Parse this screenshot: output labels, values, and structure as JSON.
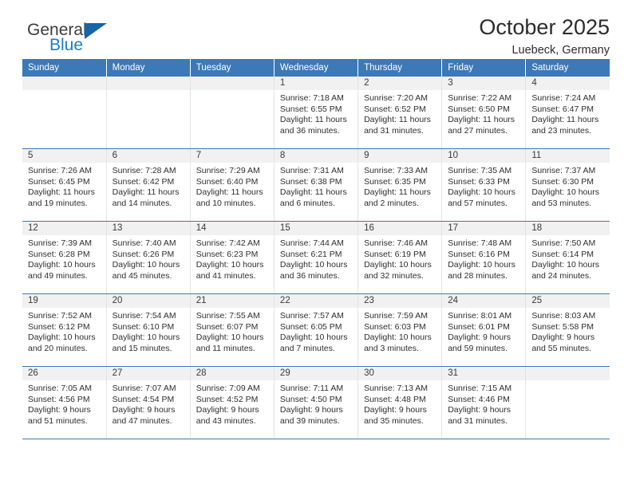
{
  "brand": {
    "name_top": "General",
    "name_bottom": "Blue",
    "flag_color": "#1565a8",
    "blue_color": "#1f7cc4"
  },
  "header": {
    "title": "October 2025",
    "subtitle": "Luebeck, Germany",
    "header_bg": "#3b79b8",
    "header_text_color": "#ffffff",
    "daynum_bg": "#f1f1f1"
  },
  "weekday_headers": [
    "Sunday",
    "Monday",
    "Tuesday",
    "Wednesday",
    "Thursday",
    "Friday",
    "Saturday"
  ],
  "weeks": [
    [
      {
        "day": "",
        "sunrise": "",
        "sunset": "",
        "daylight_1": "",
        "daylight_2": ""
      },
      {
        "day": "",
        "sunrise": "",
        "sunset": "",
        "daylight_1": "",
        "daylight_2": ""
      },
      {
        "day": "",
        "sunrise": "",
        "sunset": "",
        "daylight_1": "",
        "daylight_2": ""
      },
      {
        "day": "1",
        "sunrise": "Sunrise: 7:18 AM",
        "sunset": "Sunset: 6:55 PM",
        "daylight_1": "Daylight: 11 hours",
        "daylight_2": "and 36 minutes."
      },
      {
        "day": "2",
        "sunrise": "Sunrise: 7:20 AM",
        "sunset": "Sunset: 6:52 PM",
        "daylight_1": "Daylight: 11 hours",
        "daylight_2": "and 31 minutes."
      },
      {
        "day": "3",
        "sunrise": "Sunrise: 7:22 AM",
        "sunset": "Sunset: 6:50 PM",
        "daylight_1": "Daylight: 11 hours",
        "daylight_2": "and 27 minutes."
      },
      {
        "day": "4",
        "sunrise": "Sunrise: 7:24 AM",
        "sunset": "Sunset: 6:47 PM",
        "daylight_1": "Daylight: 11 hours",
        "daylight_2": "and 23 minutes."
      }
    ],
    [
      {
        "day": "5",
        "sunrise": "Sunrise: 7:26 AM",
        "sunset": "Sunset: 6:45 PM",
        "daylight_1": "Daylight: 11 hours",
        "daylight_2": "and 19 minutes."
      },
      {
        "day": "6",
        "sunrise": "Sunrise: 7:28 AM",
        "sunset": "Sunset: 6:42 PM",
        "daylight_1": "Daylight: 11 hours",
        "daylight_2": "and 14 minutes."
      },
      {
        "day": "7",
        "sunrise": "Sunrise: 7:29 AM",
        "sunset": "Sunset: 6:40 PM",
        "daylight_1": "Daylight: 11 hours",
        "daylight_2": "and 10 minutes."
      },
      {
        "day": "8",
        "sunrise": "Sunrise: 7:31 AM",
        "sunset": "Sunset: 6:38 PM",
        "daylight_1": "Daylight: 11 hours",
        "daylight_2": "and 6 minutes."
      },
      {
        "day": "9",
        "sunrise": "Sunrise: 7:33 AM",
        "sunset": "Sunset: 6:35 PM",
        "daylight_1": "Daylight: 11 hours",
        "daylight_2": "and 2 minutes."
      },
      {
        "day": "10",
        "sunrise": "Sunrise: 7:35 AM",
        "sunset": "Sunset: 6:33 PM",
        "daylight_1": "Daylight: 10 hours",
        "daylight_2": "and 57 minutes."
      },
      {
        "day": "11",
        "sunrise": "Sunrise: 7:37 AM",
        "sunset": "Sunset: 6:30 PM",
        "daylight_1": "Daylight: 10 hours",
        "daylight_2": "and 53 minutes."
      }
    ],
    [
      {
        "day": "12",
        "sunrise": "Sunrise: 7:39 AM",
        "sunset": "Sunset: 6:28 PM",
        "daylight_1": "Daylight: 10 hours",
        "daylight_2": "and 49 minutes."
      },
      {
        "day": "13",
        "sunrise": "Sunrise: 7:40 AM",
        "sunset": "Sunset: 6:26 PM",
        "daylight_1": "Daylight: 10 hours",
        "daylight_2": "and 45 minutes."
      },
      {
        "day": "14",
        "sunrise": "Sunrise: 7:42 AM",
        "sunset": "Sunset: 6:23 PM",
        "daylight_1": "Daylight: 10 hours",
        "daylight_2": "and 41 minutes."
      },
      {
        "day": "15",
        "sunrise": "Sunrise: 7:44 AM",
        "sunset": "Sunset: 6:21 PM",
        "daylight_1": "Daylight: 10 hours",
        "daylight_2": "and 36 minutes."
      },
      {
        "day": "16",
        "sunrise": "Sunrise: 7:46 AM",
        "sunset": "Sunset: 6:19 PM",
        "daylight_1": "Daylight: 10 hours",
        "daylight_2": "and 32 minutes."
      },
      {
        "day": "17",
        "sunrise": "Sunrise: 7:48 AM",
        "sunset": "Sunset: 6:16 PM",
        "daylight_1": "Daylight: 10 hours",
        "daylight_2": "and 28 minutes."
      },
      {
        "day": "18",
        "sunrise": "Sunrise: 7:50 AM",
        "sunset": "Sunset: 6:14 PM",
        "daylight_1": "Daylight: 10 hours",
        "daylight_2": "and 24 minutes."
      }
    ],
    [
      {
        "day": "19",
        "sunrise": "Sunrise: 7:52 AM",
        "sunset": "Sunset: 6:12 PM",
        "daylight_1": "Daylight: 10 hours",
        "daylight_2": "and 20 minutes."
      },
      {
        "day": "20",
        "sunrise": "Sunrise: 7:54 AM",
        "sunset": "Sunset: 6:10 PM",
        "daylight_1": "Daylight: 10 hours",
        "daylight_2": "and 15 minutes."
      },
      {
        "day": "21",
        "sunrise": "Sunrise: 7:55 AM",
        "sunset": "Sunset: 6:07 PM",
        "daylight_1": "Daylight: 10 hours",
        "daylight_2": "and 11 minutes."
      },
      {
        "day": "22",
        "sunrise": "Sunrise: 7:57 AM",
        "sunset": "Sunset: 6:05 PM",
        "daylight_1": "Daylight: 10 hours",
        "daylight_2": "and 7 minutes."
      },
      {
        "day": "23",
        "sunrise": "Sunrise: 7:59 AM",
        "sunset": "Sunset: 6:03 PM",
        "daylight_1": "Daylight: 10 hours",
        "daylight_2": "and 3 minutes."
      },
      {
        "day": "24",
        "sunrise": "Sunrise: 8:01 AM",
        "sunset": "Sunset: 6:01 PM",
        "daylight_1": "Daylight: 9 hours",
        "daylight_2": "and 59 minutes."
      },
      {
        "day": "25",
        "sunrise": "Sunrise: 8:03 AM",
        "sunset": "Sunset: 5:58 PM",
        "daylight_1": "Daylight: 9 hours",
        "daylight_2": "and 55 minutes."
      }
    ],
    [
      {
        "day": "26",
        "sunrise": "Sunrise: 7:05 AM",
        "sunset": "Sunset: 4:56 PM",
        "daylight_1": "Daylight: 9 hours",
        "daylight_2": "and 51 minutes."
      },
      {
        "day": "27",
        "sunrise": "Sunrise: 7:07 AM",
        "sunset": "Sunset: 4:54 PM",
        "daylight_1": "Daylight: 9 hours",
        "daylight_2": "and 47 minutes."
      },
      {
        "day": "28",
        "sunrise": "Sunrise: 7:09 AM",
        "sunset": "Sunset: 4:52 PM",
        "daylight_1": "Daylight: 9 hours",
        "daylight_2": "and 43 minutes."
      },
      {
        "day": "29",
        "sunrise": "Sunrise: 7:11 AM",
        "sunset": "Sunset: 4:50 PM",
        "daylight_1": "Daylight: 9 hours",
        "daylight_2": "and 39 minutes."
      },
      {
        "day": "30",
        "sunrise": "Sunrise: 7:13 AM",
        "sunset": "Sunset: 4:48 PM",
        "daylight_1": "Daylight: 9 hours",
        "daylight_2": "and 35 minutes."
      },
      {
        "day": "31",
        "sunrise": "Sunrise: 7:15 AM",
        "sunset": "Sunset: 4:46 PM",
        "daylight_1": "Daylight: 9 hours",
        "daylight_2": "and 31 minutes."
      },
      {
        "day": "",
        "sunrise": "",
        "sunset": "",
        "daylight_1": "",
        "daylight_2": ""
      }
    ]
  ]
}
